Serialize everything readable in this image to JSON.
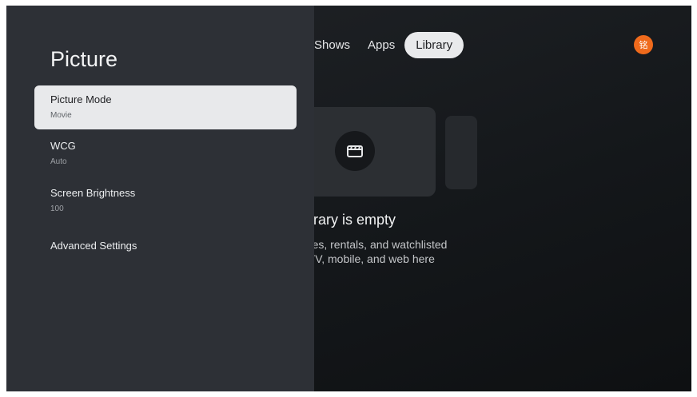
{
  "top_nav": {
    "tabs": [
      {
        "label": "Shows"
      },
      {
        "label": "Apps"
      },
      {
        "label": "Library"
      }
    ],
    "avatar_initial": "铭"
  },
  "library": {
    "empty_title": "Library is empty",
    "empty_description_line1": "hases, rentals, and watchlisted",
    "empty_description_line2": "ss TV, mobile, and web here",
    "icon": "film-clapper-icon"
  },
  "settings_panel": {
    "title": "Picture",
    "items": [
      {
        "label": "Picture Mode",
        "value": "Movie",
        "selected": true
      },
      {
        "label": "WCG",
        "value": "Auto",
        "selected": false
      },
      {
        "label": "Screen Brightness",
        "value": "100",
        "selected": false
      },
      {
        "label": "Advanced Settings",
        "value": "",
        "selected": false
      }
    ]
  },
  "colors": {
    "panel_bg": "#2d3036",
    "selected_bg": "#e8e9eb",
    "avatar_bg": "#ef6a1c"
  }
}
